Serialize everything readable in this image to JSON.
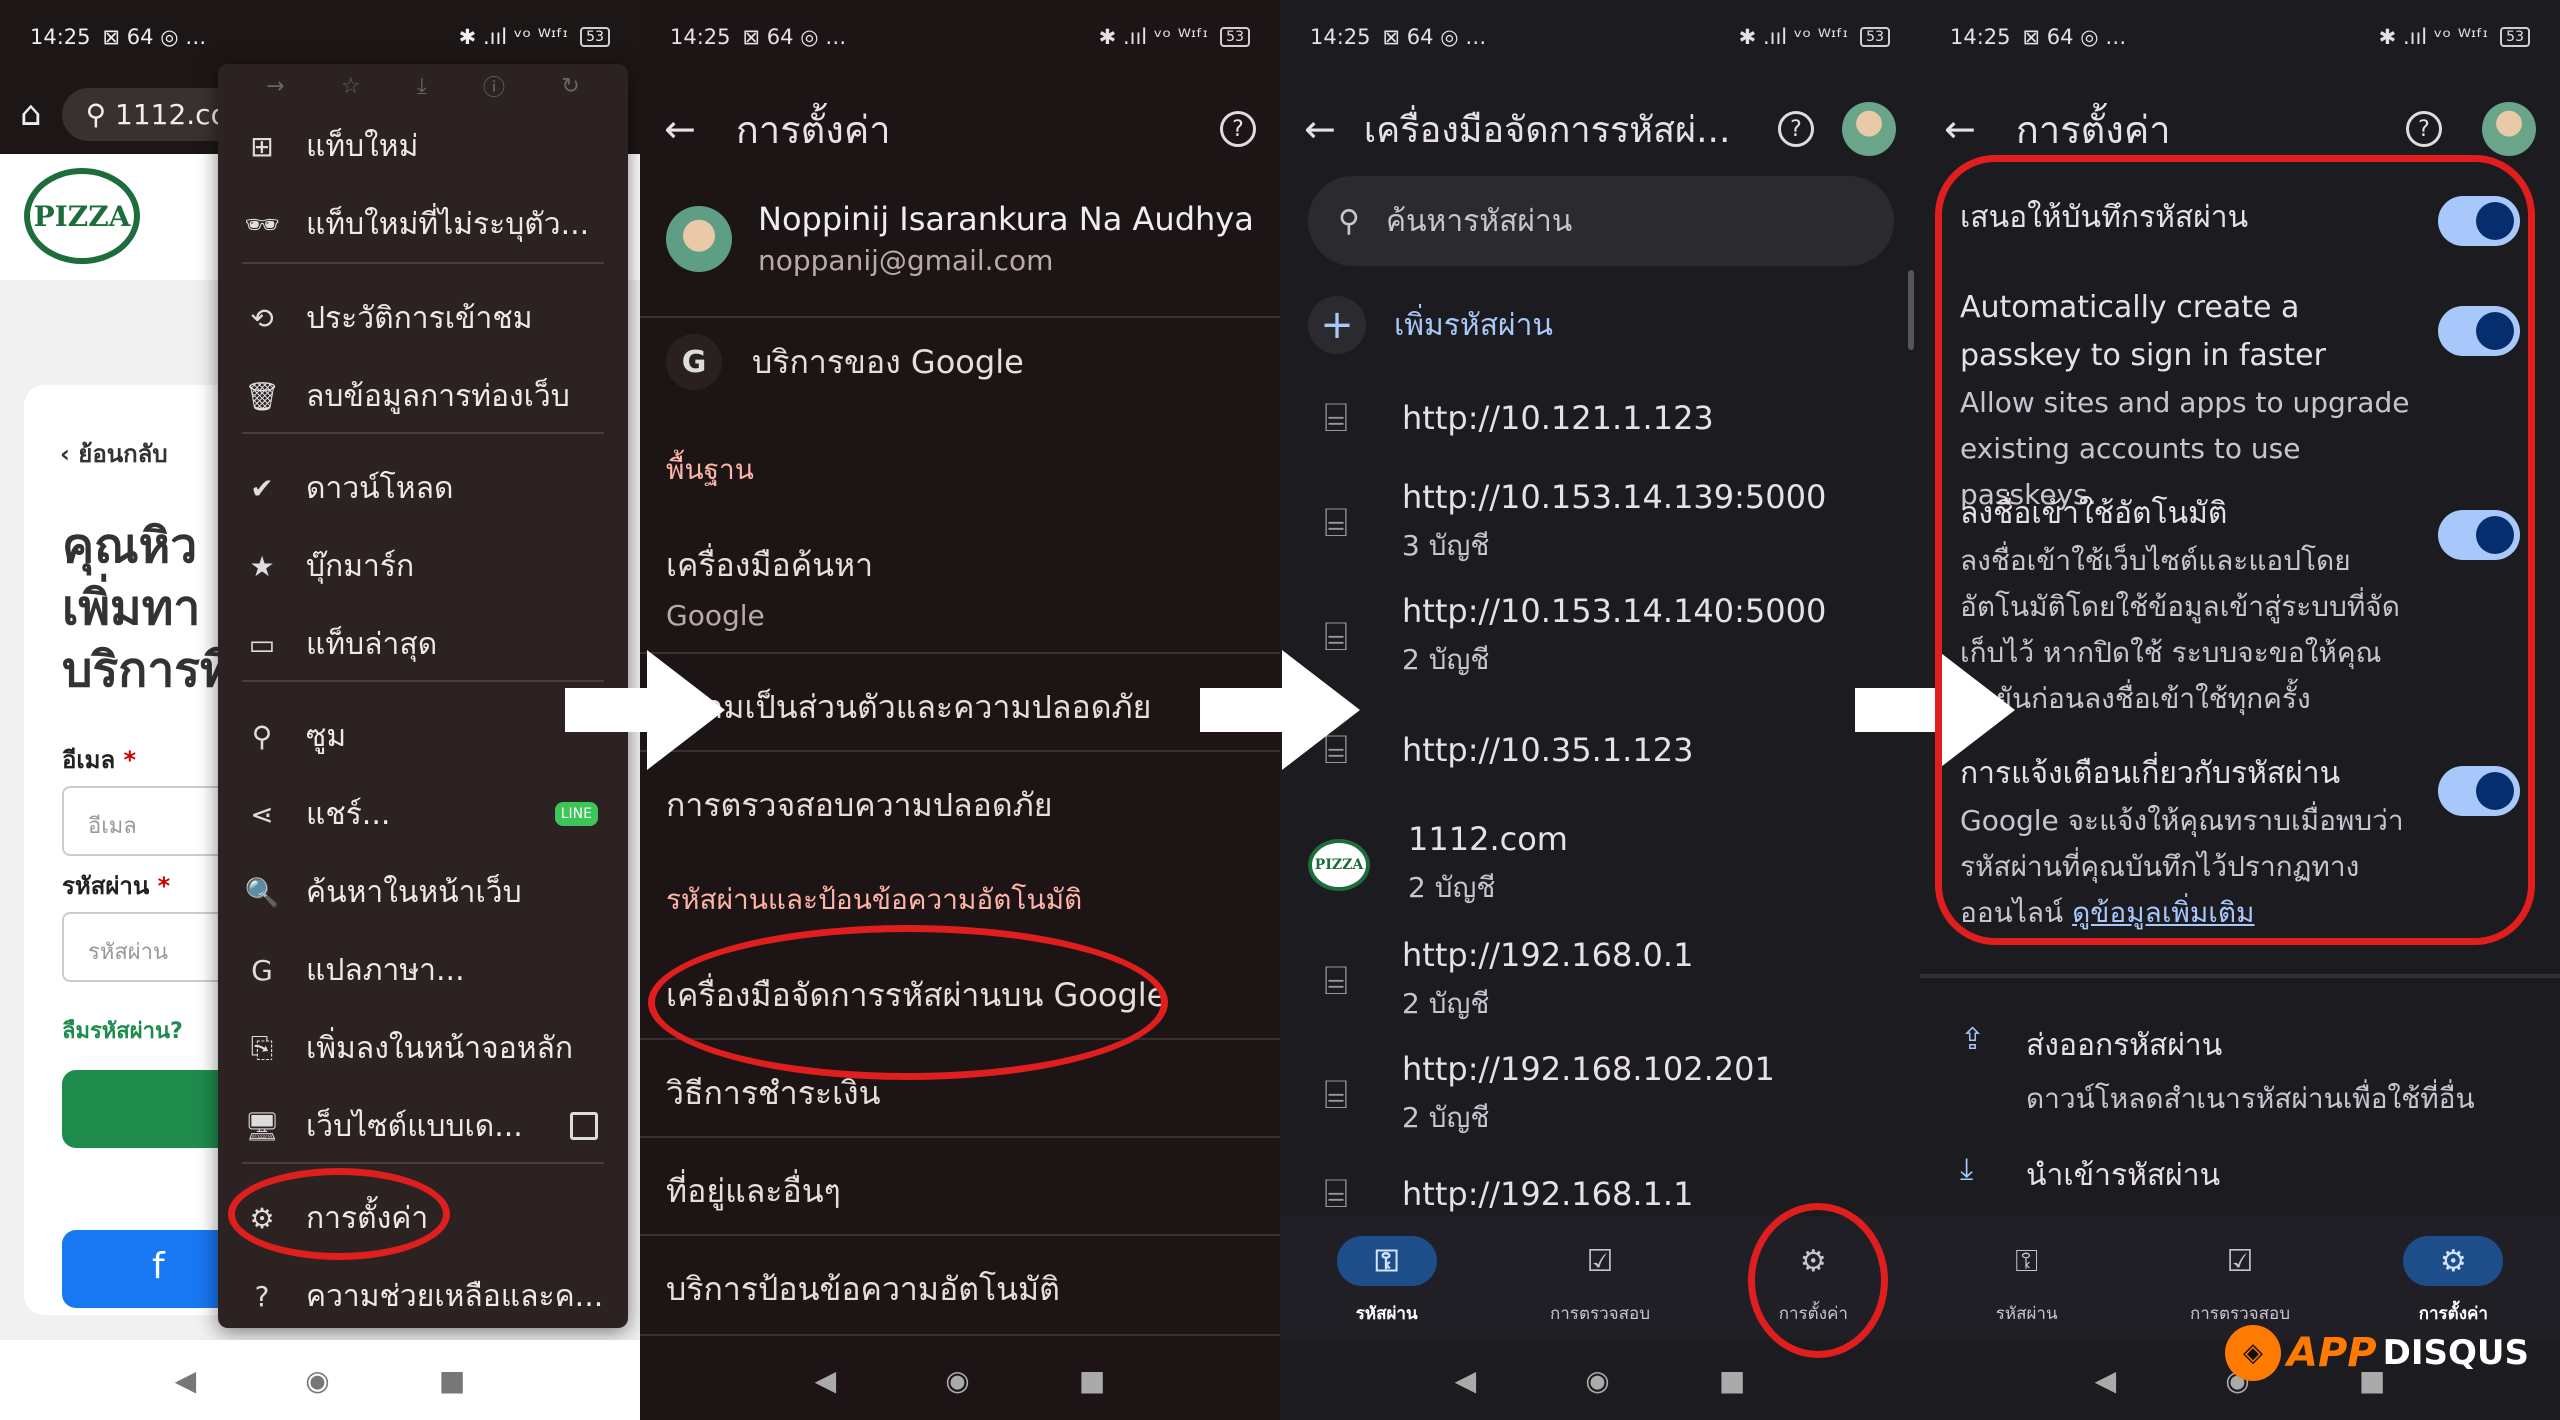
{
  "status": {
    "time": "14:25",
    "indicators": "⊠ 64 ◎ …",
    "right": "✱ .ııl ᵛᵒ ᵂᶦᶠᶦ",
    "battery": "53"
  },
  "panel1": {
    "url": "1112.co",
    "menu_items": [
      {
        "icon": "plus-square-icon",
        "glyph": "⊞",
        "label": "แท็บใหม่"
      },
      {
        "icon": "incognito-icon",
        "glyph": "🕶",
        "label": "แท็บใหม่ที่ไม่ระบุตัว..."
      },
      {
        "icon": "history-icon",
        "glyph": "⟲",
        "label": "ประวัติการเข้าชม"
      },
      {
        "icon": "trash-icon",
        "glyph": "🗑",
        "label": "ลบข้อมูลการท่องเว็บ"
      },
      {
        "icon": "download-icon",
        "glyph": "✔",
        "label": "ดาวน์โหลด"
      },
      {
        "icon": "star-icon",
        "glyph": "★",
        "label": "บุ๊กมาร์ก"
      },
      {
        "icon": "recent-tabs-icon",
        "glyph": "▭",
        "label": "แท็บล่าสุด"
      },
      {
        "icon": "zoom-icon",
        "glyph": "⚲",
        "label": "ซูม"
      },
      {
        "icon": "share-icon",
        "glyph": "⋖",
        "label": "แชร์..."
      },
      {
        "icon": "find-in-page-icon",
        "glyph": "🔍",
        "label": "ค้นหาในหน้าเว็บ"
      },
      {
        "icon": "translate-icon",
        "glyph": "G",
        "label": "แปลภาษา..."
      },
      {
        "icon": "add-to-home-icon",
        "glyph": "⎘",
        "label": "เพิ่มลงในหน้าจอหลัก"
      },
      {
        "icon": "desktop-icon",
        "glyph": "🖥",
        "label": "เว็บไซต์แบบเด..."
      },
      {
        "icon": "gear-icon",
        "glyph": "⚙",
        "label": "การตั้งค่า"
      },
      {
        "icon": "help-icon",
        "glyph": "?",
        "label": "ความช่วยเหลือและค..."
      }
    ],
    "line_badge": "LINE",
    "web": {
      "logo": "PIZZA",
      "back": "ย้อนกลับ",
      "title": "คุณหิว เพิ่มทา บริการที่",
      "email_label": "อีเมล",
      "email_placeholder": "อีเมล",
      "password_label": "รหัสผ่าน",
      "password_placeholder": "รหัสผ่าน",
      "forgot": "ลืมรหัสผ่าน?",
      "fb": "f"
    }
  },
  "panel2": {
    "title": "การตั้งค่า",
    "account_name": "Noppinij Isarankura Na Audhya",
    "account_email": "noppanij@gmail.com",
    "google_services": "บริการของ Google",
    "section_basics": "พื้นฐาน",
    "search_engine": "เครื่องมือค้นหา",
    "search_engine_value": "Google",
    "privacy": "ความเป็นส่วนตัวและความปลอดภัย",
    "safety_check": "การตรวจสอบความปลอดภัย",
    "section_autofill": "รหัสผ่านและป้อนข้อความอัตโนมัติ",
    "password_manager": "เครื่องมือจัดการรหัสผ่านบน Google",
    "payment": "วิธีการชำระเงิน",
    "addresses": "ที่อยู่และอื่นๆ",
    "autofill_service": "บริการป้อนข้อความอัตโนมัติ"
  },
  "panel3": {
    "title": "เครื่องมือจัดการรหัสผ่...",
    "search_placeholder": "ค้นหารหัสผ่าน",
    "add_password": "เพิ่มรหัสผ่าน",
    "passwords": [
      {
        "site": "http://10.121.1.123",
        "count": ""
      },
      {
        "site": "http://10.153.14.139:5000",
        "count": "3 บัญชี"
      },
      {
        "site": "http://10.153.14.140:5000",
        "count": "2 บัญชี"
      },
      {
        "site": "http://10.35.1.123",
        "count": ""
      },
      {
        "site": "1112.com",
        "count": "2 บัญชี"
      },
      {
        "site": "http://192.168.0.1",
        "count": "2 บัญชี"
      },
      {
        "site": "http://192.168.102.201",
        "count": "2 บัญชี"
      },
      {
        "site": "http://192.168.1.1",
        "count": ""
      }
    ],
    "nav": [
      {
        "label": "รหัสผ่าน",
        "icon": "key-icon"
      },
      {
        "label": "การตรวจสอบ",
        "icon": "checkup-icon"
      },
      {
        "label": "การตั้งค่า",
        "icon": "gear-icon"
      }
    ]
  },
  "panel4": {
    "title": "การตั้งค่า",
    "offer_to_save": "เสนอให้บันทึกรหัสผ่าน",
    "passkey_title": "Automatically create a passkey to sign in faster",
    "passkey_desc": "Allow sites and apps to upgrade existing accounts to use passkeys.",
    "auto_signin_title": "ลงชื่อเข้าใช้อัตโนมัติ",
    "auto_signin_desc": "ลงชื่อเข้าใช้เว็บไซต์และแอปโดยอัตโนมัติโดยใช้ข้อมูลเข้าสู่ระบบที่จัดเก็บไว้ หากปิดใช้ ระบบจะขอให้คุณยืนยันก่อนลงชื่อเข้าใช้ทุกครั้ง",
    "alerts_title": "การแจ้งเตือนเกี่ยวกับรหัสผ่าน",
    "alerts_desc": "Google จะแจ้งให้คุณทราบเมื่อพบว่ารหัสผ่านที่คุณบันทึกไว้ปรากฏทางออนไลน์",
    "alerts_link": "ดูข้อมูลเพิ่มเติม",
    "export_title": "ส่งออกรหัสผ่าน",
    "export_desc": "ดาวน์โหลดสำเนารหัสผ่านเพื่อใช้ที่อื่น",
    "import_title": "นำเข้ารหัสผ่าน",
    "toggles_on": [
      true,
      true,
      true,
      true
    ]
  },
  "watermark": {
    "app": "APP",
    "disqus": "DISQUS"
  },
  "colors": {
    "annotation_red": "#e01e1e",
    "accent_blue": "#a8c7fa",
    "pizza_green": "#1e6b3c"
  }
}
